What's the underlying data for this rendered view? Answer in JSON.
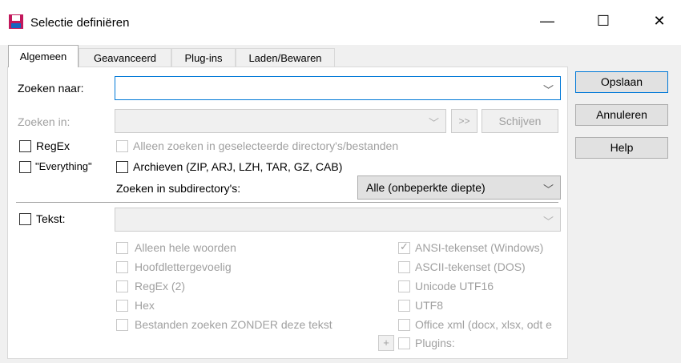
{
  "window": {
    "title": "Selectie definiëren",
    "minimize": "—",
    "maximize": "☐",
    "close": "✕"
  },
  "tabs": [
    "Algemeen",
    "Geavanceerd",
    "Plug-ins",
    "Laden/Bewaren"
  ],
  "side_buttons": {
    "save": "Opslaan",
    "cancel": "Annuleren",
    "help": "Help"
  },
  "search": {
    "search_for_label": "Zoeken naar:",
    "search_for_value": "",
    "search_in_label": "Zoeken in:",
    "search_in_value": "",
    "arrows_button": ">>",
    "drives_button": "Schijven",
    "regex_label": "RegEx",
    "everything_label": "\"Everything\"",
    "only_selected_label": "Alleen zoeken in geselecteerde directory's/bestanden",
    "archives_label": "Archieven (ZIP, ARJ, LZH, TAR, GZ, CAB)",
    "subdirs_label": "Zoeken in subdirectory's:",
    "subdirs_value": "Alle (onbeperkte diepte)"
  },
  "text_search": {
    "text_label": "Tekst:",
    "text_value": "",
    "left_options": [
      "Alleen hele woorden",
      "Hoofdlettergevoelig",
      "RegEx (2)",
      "Hex",
      "Bestanden zoeken ZONDER deze tekst"
    ],
    "right_options": [
      "ANSI-tekenset (Windows)",
      "ASCII-tekenset (DOS)",
      "Unicode UTF16",
      "UTF8",
      "Office xml (docx, xlsx, odt e",
      "Plugins:"
    ],
    "right_checked": [
      true,
      false,
      false,
      false,
      false,
      false
    ],
    "plus_button": "+"
  }
}
